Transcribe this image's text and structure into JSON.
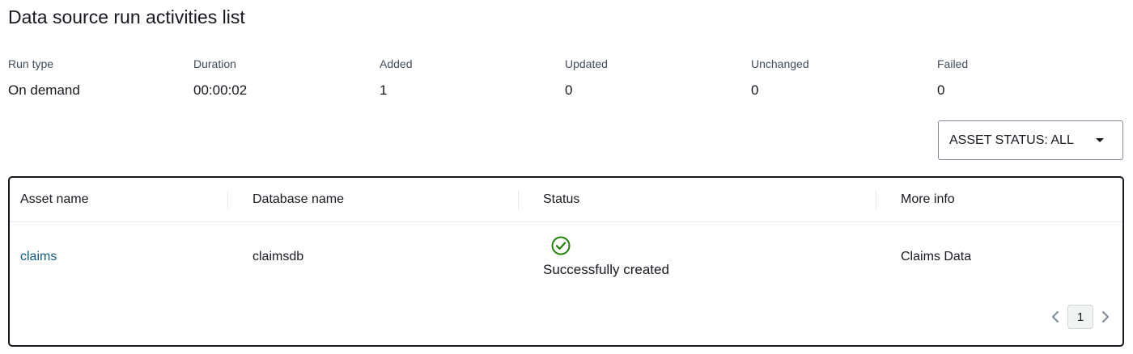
{
  "page": {
    "title": "Data source run activities list"
  },
  "summary": [
    {
      "label": "Run type",
      "value": "On demand"
    },
    {
      "label": "Duration",
      "value": "00:00:02"
    },
    {
      "label": "Added",
      "value": "1"
    },
    {
      "label": "Updated",
      "value": "0"
    },
    {
      "label": "Unchanged",
      "value": "0"
    },
    {
      "label": "Failed",
      "value": "0"
    }
  ],
  "filter": {
    "label": "ASSET STATUS: ALL",
    "icon": "caret-down-icon"
  },
  "table": {
    "columns": [
      "Asset name",
      "Database name",
      "Status",
      "More info"
    ],
    "rows": [
      {
        "asset_name": "claims",
        "database_name": "claimsdb",
        "status": "Successfully created",
        "status_icon": "check-circle-icon",
        "more_info": "Claims Data"
      }
    ]
  },
  "pagination": {
    "current_page": "1",
    "prev_icon": "chevron-left-icon",
    "next_icon": "chevron-right-icon"
  },
  "colors": {
    "link": "#0b5d82",
    "success": "#1d8102",
    "text": "#16191f",
    "border": "#16191f"
  }
}
